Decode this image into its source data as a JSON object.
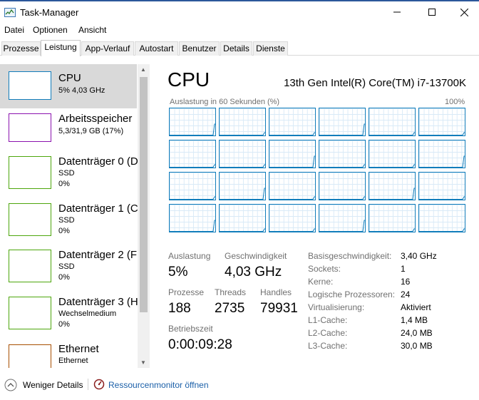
{
  "window": {
    "title": "Task-Manager"
  },
  "menu": [
    "Datei",
    "Optionen",
    "Ansicht"
  ],
  "tabs": [
    "Prozesse",
    "Leistung",
    "App-Verlauf",
    "Autostart",
    "Benutzer",
    "Details",
    "Dienste"
  ],
  "active_tab": "Leistung",
  "resources": [
    {
      "title": "CPU",
      "line1": "5% 4,03 GHz",
      "line2": "",
      "color": "#117dbb",
      "selected": true
    },
    {
      "title": "Arbeitsspeicher",
      "line1": "5,3/31,9 GB (17%)",
      "line2": "",
      "color": "#8b12ae",
      "selected": false
    },
    {
      "title": "Datenträger 0 (D",
      "line1": "SSD",
      "line2": "0%",
      "color": "#4da60c",
      "selected": false
    },
    {
      "title": "Datenträger 1 (C",
      "line1": "SSD",
      "line2": "0%",
      "color": "#4da60c",
      "selected": false
    },
    {
      "title": "Datenträger 2 (F",
      "line1": "SSD",
      "line2": "0%",
      "color": "#4da60c",
      "selected": false
    },
    {
      "title": "Datenträger 3 (H",
      "line1": "Wechselmedium",
      "line2": "0%",
      "color": "#4da60c",
      "selected": false
    },
    {
      "title": "Ethernet",
      "line1": "Ethernet",
      "line2": "",
      "color": "#a74f01",
      "selected": false
    }
  ],
  "detail": {
    "heading": "CPU",
    "model": "13th Gen Intel(R) Core(TM) i7-13700K",
    "graph_caption": "Auslastung in 60 Sekunden (%)",
    "graph_max": "100%",
    "core_graph_color": "#117dbb"
  },
  "stats": {
    "auslastung_label": "Auslastung",
    "auslastung_value": "5%",
    "geschwindigkeit_label": "Geschwindigkeit",
    "geschwindigkeit_value": "4,03 GHz",
    "prozesse_label": "Prozesse",
    "prozesse_value": "188",
    "threads_label": "Threads",
    "threads_value": "2735",
    "handles_label": "Handles",
    "handles_value": "79931",
    "betriebszeit_label": "Betriebszeit",
    "betriebszeit_value": "0:00:09:28"
  },
  "specs": [
    {
      "label": "Basisgeschwindigkeit:",
      "value": "3,40 GHz"
    },
    {
      "label": "Sockets:",
      "value": "1"
    },
    {
      "label": "Kerne:",
      "value": "16"
    },
    {
      "label": "Logische Prozessoren:",
      "value": "24"
    },
    {
      "label": "Virtualisierung:",
      "value": "Aktiviert"
    },
    {
      "label": "L1-Cache:",
      "value": "1,4 MB"
    },
    {
      "label": "L2-Cache:",
      "value": "24,0 MB"
    },
    {
      "label": "L3-Cache:",
      "value": "30,0 MB"
    }
  ],
  "footer": {
    "fewer_details": "Weniger Details",
    "resource_monitor": "Ressourcenmonitor öffnen"
  }
}
